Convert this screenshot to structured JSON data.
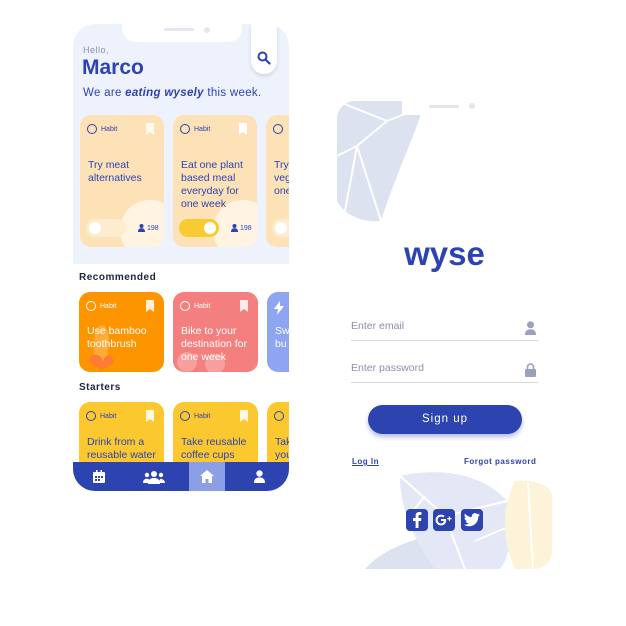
{
  "home": {
    "greeting": "Hello,",
    "user_name": "Marco",
    "tagline_prefix": "We are ",
    "tagline_emphasis": "eating wysely",
    "tagline_suffix": " this week.",
    "habit_cards": [
      {
        "tag": "Habit",
        "title": "Try meat alternatives",
        "count": "198",
        "toggle_on": false
      },
      {
        "tag": "Habit",
        "title": "Eat one plant based meal everyday for one week",
        "count": "198",
        "toggle_on": true
      },
      {
        "tag": "Habit",
        "title": "Try veg one"
      }
    ],
    "recommended_label": "Recommended",
    "recommended_cards": [
      {
        "tag": "Habit",
        "title": "Use bamboo toothbrush",
        "color": "#fd9500"
      },
      {
        "tag": "Habit",
        "title": "Bike to your destination for one week",
        "color": "#f47f7f"
      },
      {
        "tag": "",
        "title": "Sw bu",
        "color": "#8ea5f4"
      }
    ],
    "starters_label": "Starters",
    "starter_cards": [
      {
        "tag": "Habit",
        "title": "Drink from a reusable water"
      },
      {
        "tag": "Habit",
        "title": "Take reusable coffee cups with"
      },
      {
        "tag": "Habit",
        "title": "Tak you"
      }
    ],
    "tabs": [
      "calendar-icon",
      "group-icon",
      "home-icon",
      "profile-icon"
    ],
    "active_tab": "home-icon"
  },
  "signup": {
    "logo": "wyse",
    "email_placeholder": "Enter email",
    "password_placeholder": "Enter password",
    "signup_label": "Sign up",
    "login_label": "Log In",
    "forgot_label": "Forgot password",
    "social": [
      "facebook-icon",
      "google-plus-icon",
      "twitter-icon"
    ]
  },
  "colors": {
    "brand_blue": "#2d43b0",
    "peach": "#fde2b8",
    "yellow": "#fbc830",
    "orange": "#fd9500",
    "coral": "#f47f7f",
    "periwinkle": "#8ea5f4"
  }
}
